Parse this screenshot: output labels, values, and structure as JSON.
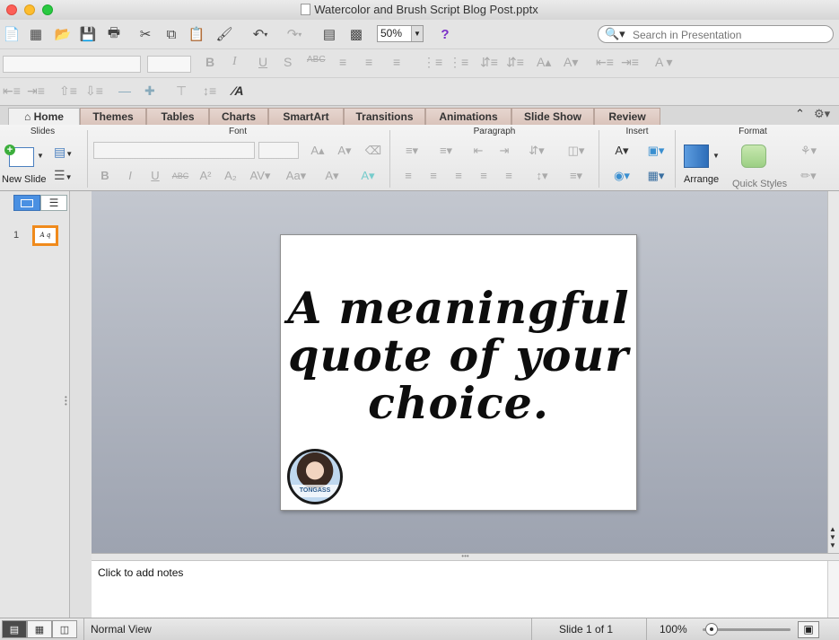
{
  "window": {
    "title": "Watercolor and Brush Script Blog Post.pptx",
    "colors": {
      "close": "#fc5f57",
      "minimize": "#fdbd2e",
      "zoom": "#29c941"
    }
  },
  "toolbar": {
    "zoom_value": "50%",
    "search_placeholder": "Search in Presentation",
    "icons": [
      "new-icon",
      "gallery-icon",
      "open-icon",
      "save-icon",
      "print-icon",
      "cut-icon",
      "copy-icon",
      "paste-icon",
      "format-painter-icon",
      "undo-icon",
      "redo-icon",
      "sidebar-icon",
      "media-browser-icon",
      "help-icon"
    ]
  },
  "tabs": [
    {
      "label": "Home",
      "active": true
    },
    {
      "label": "Themes"
    },
    {
      "label": "Tables"
    },
    {
      "label": "Charts"
    },
    {
      "label": "SmartArt"
    },
    {
      "label": "Transitions"
    },
    {
      "label": "Animations"
    },
    {
      "label": "Slide Show"
    },
    {
      "label": "Review"
    }
  ],
  "ribbon": {
    "groups": {
      "slides": "Slides",
      "font": "Font",
      "paragraph": "Paragraph",
      "insert": "Insert",
      "format": "Format"
    },
    "new_slide_label": "New Slide",
    "arrange_label": "Arrange",
    "quick_styles_label": "Quick Styles"
  },
  "slides_panel": {
    "slide_number": "1",
    "thumb_text": "A q"
  },
  "slide": {
    "quote": "A meaningful quote of your choice.",
    "avatar_caption": "TONGASS"
  },
  "notes": {
    "placeholder": "Click to add notes"
  },
  "status": {
    "view_name": "Normal View",
    "slide_position": "Slide 1 of 1",
    "zoom": "100%",
    "zoom_slider_level": 0.1
  }
}
